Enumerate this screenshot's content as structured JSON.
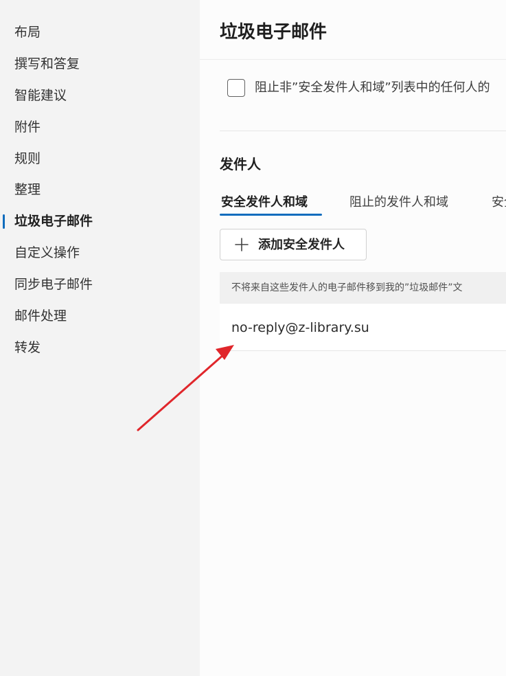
{
  "sidebar": {
    "items": [
      {
        "label": "布局"
      },
      {
        "label": "撰写和答复"
      },
      {
        "label": "智能建议"
      },
      {
        "label": "附件"
      },
      {
        "label": "规则"
      },
      {
        "label": "整理"
      },
      {
        "label": "垃圾电子邮件",
        "active": true
      },
      {
        "label": "自定义操作"
      },
      {
        "label": "同步电子邮件"
      },
      {
        "label": "邮件处理"
      },
      {
        "label": "转发"
      }
    ]
  },
  "main": {
    "title": "垃圾电子邮件",
    "block_checkbox_label": "阻止非”安全发件人和域”列表中的任何人的",
    "block_checkbox_checked": false,
    "senders_section_title": "发件人",
    "tabs": [
      {
        "label": "安全发件人和域",
        "active": true
      },
      {
        "label": "阻止的发件人和域"
      },
      {
        "label": "安全"
      }
    ],
    "add_button_label": "添加安全发件人",
    "list_header": "不将来自这些发件人的电子邮件移到我的”垃圾邮件”文",
    "list_items": [
      "no-reply@z-library.su"
    ]
  },
  "colors": {
    "accent": "#0f6cbd",
    "annotation_arrow": "#e0262b"
  },
  "icons": {
    "add_button_icon": "plus-icon"
  }
}
